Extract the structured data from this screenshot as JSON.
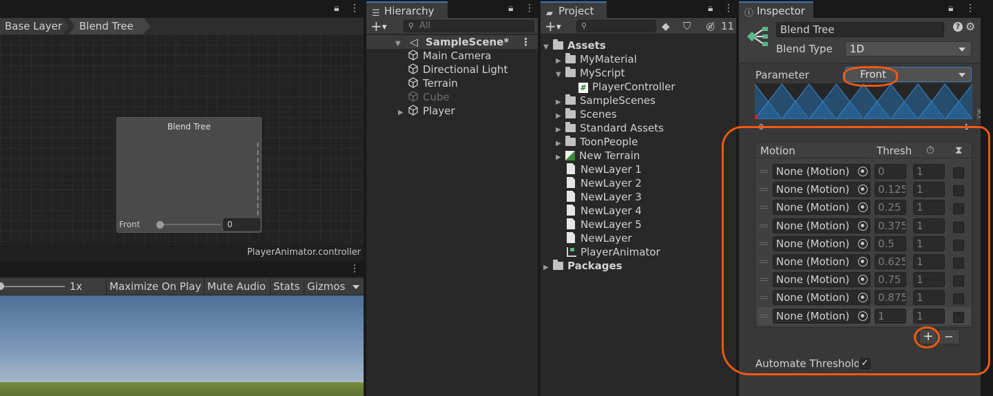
{
  "animator": {
    "breadcrumbs": [
      "Base Layer",
      "Blend Tree"
    ],
    "node_title": "Blend Tree",
    "node_param_label": "Front",
    "node_param_value": "0",
    "footer_file": "PlayerAnimator.controller"
  },
  "game": {
    "scale": "1x",
    "buttons": [
      "Maximize On Play",
      "Mute Audio",
      "Stats",
      "Gizmos"
    ]
  },
  "hierarchy": {
    "tab": "Hierarchy",
    "search_placeholder": "All",
    "scene": "SampleScene*",
    "items": [
      "Main Camera",
      "Directional Light",
      "Terrain",
      "Cube",
      "Player"
    ]
  },
  "project": {
    "tab": "Project",
    "hidden_count": "11",
    "assets_label": "Assets",
    "folders": [
      "MyMaterial",
      "MyScript"
    ],
    "script": "PlayerController",
    "more_folders": [
      "SampleScenes",
      "Scenes",
      "Standard Assets",
      "ToonPeople"
    ],
    "terrain": "New Terrain",
    "layers": [
      "NewLayer 1",
      "NewLayer 2",
      "NewLayer 3",
      "NewLayer 4",
      "NewLayer 5",
      "NewLayer"
    ],
    "animator": "PlayerAnimator",
    "packages": "Packages"
  },
  "inspector": {
    "tab": "Inspector",
    "name": "Blend Tree",
    "blend_type_label": "Blend Type",
    "blend_type": "1D",
    "parameter_label": "Parameter",
    "parameter": "Front",
    "range_min": "0",
    "range_max": "1",
    "side_label": "ЖX",
    "col_motion": "Motion",
    "col_threshold": "Thresh",
    "motions": [
      {
        "motion": "None (Motion)",
        "threshold": "0",
        "speed": "1"
      },
      {
        "motion": "None (Motion)",
        "threshold": "0.125",
        "speed": "1"
      },
      {
        "motion": "None (Motion)",
        "threshold": "0.25",
        "speed": "1"
      },
      {
        "motion": "None (Motion)",
        "threshold": "0.375",
        "speed": "1"
      },
      {
        "motion": "None (Motion)",
        "threshold": "0.5",
        "speed": "1"
      },
      {
        "motion": "None (Motion)",
        "threshold": "0.625",
        "speed": "1"
      },
      {
        "motion": "None (Motion)",
        "threshold": "0.75",
        "speed": "1"
      },
      {
        "motion": "None (Motion)",
        "threshold": "0.875",
        "speed": "1"
      },
      {
        "motion": "None (Motion)",
        "threshold": "1",
        "speed": "1"
      }
    ],
    "add_symbol": "+",
    "remove_symbol": "−",
    "automate_label": "Automate Thresholds"
  },
  "colors": {
    "annotation": "#f35a0f",
    "accent": "#3a79bb"
  }
}
